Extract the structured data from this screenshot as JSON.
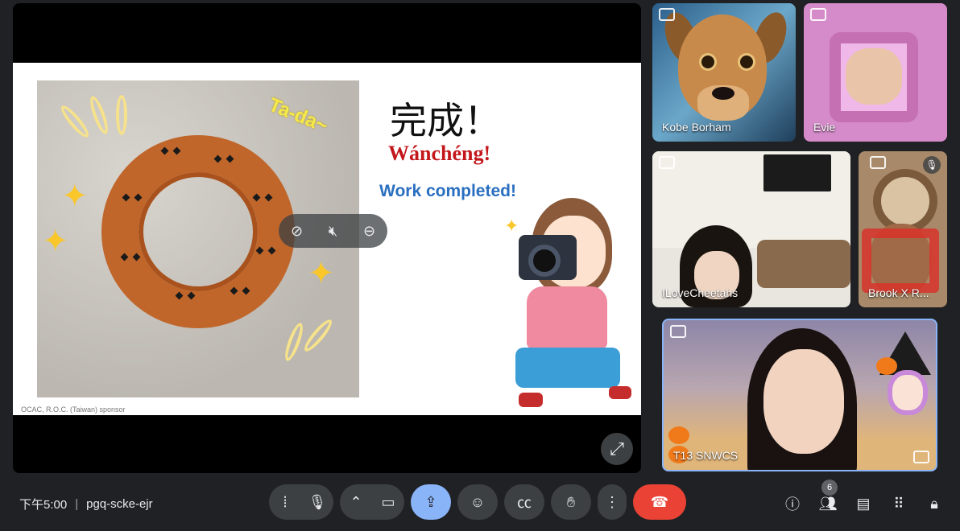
{
  "slide": {
    "title_cn": "完成！",
    "title_pinyin": "Wánchéng!",
    "title_en": "Work completed!",
    "photo_caption": "Ta-da~",
    "sponsor": "OCAC, R.O.C. (Taiwan) sponsor"
  },
  "presentation": {
    "pin_overlay_icons": [
      "unpin-icon",
      "mute-icon",
      "remove-icon"
    ],
    "expand_icon": "expand-icon"
  },
  "participants": [
    {
      "name": "Kobe Borham"
    },
    {
      "name": "Evie"
    },
    {
      "name": "ILoveCheetahs"
    },
    {
      "name": "Brook X R..."
    },
    {
      "name": "T13 SNWCS"
    }
  ],
  "bottom_bar": {
    "time": "下午5:00",
    "separator": "|",
    "meeting_code": "pgq-scke-ejr",
    "people_count": "6"
  },
  "colors": {
    "background": "#202124",
    "button": "#3c4043",
    "active_button": "#8ab4f8",
    "end_call": "#ea4335",
    "pinyin_red": "#c3171c",
    "english_blue": "#2a6fc0"
  }
}
